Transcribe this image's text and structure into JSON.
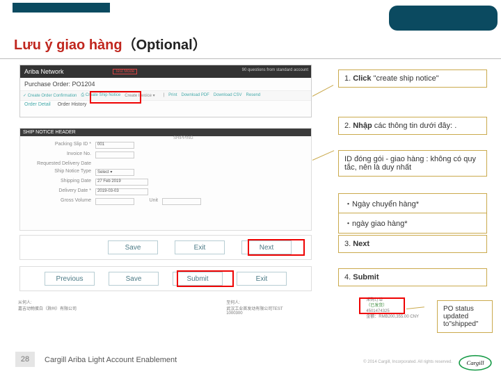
{
  "header": {
    "title_red": "Lưu ý giao hàng",
    "title_black": "（Optional）"
  },
  "ariba": {
    "brand": "Ariba Network",
    "test": "Test Mode",
    "right": "90 questions from standard account",
    "po": "Purchase Order: PO1204",
    "btn_confirm": "✓ Create Order Confirmation",
    "btn_ship": "⎙ Create Ship Notice",
    "btn_invoice": "Create Invoice ▾",
    "btn_print": "Print",
    "btn_pdf": "Download PDF",
    "btn_csv": "Download CSV",
    "btn_resend": "Resend",
    "tab_detail": "Order Detail",
    "tab_history": "Order History"
  },
  "form": {
    "head": "SHIP NOTICE HEADER",
    "sub": "SHIPPING",
    "l_packing": "Packing Slip ID *",
    "v_packing": "001",
    "l_invoice": "Invoice No.",
    "l_req": "Requested Delivery Date",
    "l_type": "Ship Notice Type",
    "v_type": "Select ▾",
    "l_shipd": "Shipping Date",
    "v_shipd": "27 Feb 2019",
    "l_deliv": "Delivery Date *",
    "v_deliv": "2019-03-03",
    "l_gross": "Gross Volume",
    "l_unit": "Unit"
  },
  "bar1": {
    "save": "Save",
    "exit": "Exit",
    "next": "Next"
  },
  "bar2": {
    "prev": "Previous",
    "save": "Save",
    "submit": "Submit",
    "exit": "Exit"
  },
  "bottom": {
    "c1a": "从何人:",
    "c1b": "嘉吉动物蛋白（滁州）有限公司",
    "c2a": "至何人:",
    "c2b": "武汉工业首发动有限公司TEST",
    "c2c": "1000300",
    "c3a": "采购订单",
    "c3b": "（已发货）",
    "c3c": "4501474325",
    "c3d": "金额：RMB200,355.00 CNY"
  },
  "annot": {
    "a1_pre": "1. ",
    "a1_b": "Click",
    "a1_post": " \"create ship notice\"",
    "a2_pre": "2. ",
    "a2_b": "Nhập",
    "a2_post": " các thông tin dưới đây: .",
    "a3": " ID đóng gói - giao hàng : không có quy tắc, nên là duy nhất",
    "a4": "・Ngày chuyển hàng*",
    "a5": "・ngày giao hàng*",
    "a6_pre": "3. ",
    "a6_b": "Next",
    "a7_pre": "4. ",
    "a7_b": "Submit",
    "a8": "PO status updated to\"shipped\""
  },
  "footer": {
    "page": "28",
    "title": "Cargill Ariba Light Account Enablement",
    "copy": "© 2014 Cargill, Incorporated. All rights reserved."
  }
}
